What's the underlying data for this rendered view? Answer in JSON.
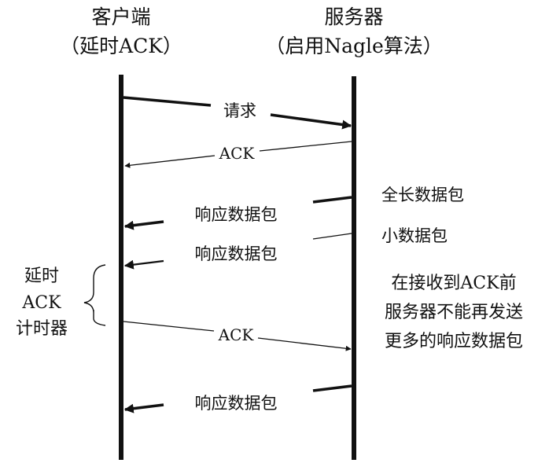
{
  "client": {
    "title": "客户端",
    "subtitle": "（延时ACK）"
  },
  "server": {
    "title": "服务器",
    "subtitle": "（启用Nagle算法）"
  },
  "messages": {
    "request": "请求",
    "ack1": "ACK",
    "resp1": "响应数据包",
    "resp2": "响应数据包",
    "ack2": "ACK",
    "resp3": "响应数据包"
  },
  "server_notes": {
    "full_packet": "全长数据包",
    "small_packet": "小数据包",
    "wait_line1": "在接收到ACK前",
    "wait_line2": "服务器不能再发送",
    "wait_line3": "更多的响应数据包"
  },
  "timer": {
    "line1": "延时",
    "line2": "ACK",
    "line3": "计时器"
  }
}
